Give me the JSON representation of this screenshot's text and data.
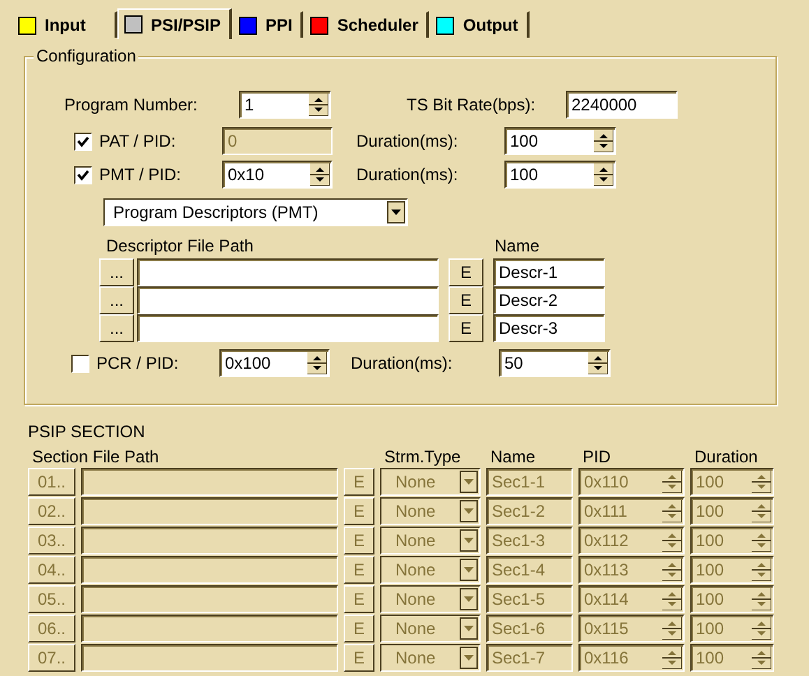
{
  "tabs": [
    {
      "label": "Input",
      "color": "#ffff00",
      "selected": false
    },
    {
      "label": "PSI/PSIP",
      "color": "#c0c0c0",
      "selected": true
    },
    {
      "label": "PPI",
      "color": "#0000ff",
      "selected": false
    },
    {
      "label": "Scheduler",
      "color": "#ff0000",
      "selected": false
    },
    {
      "label": "Output",
      "color": "#00ffff",
      "selected": false
    }
  ],
  "configuration": {
    "title": "Configuration",
    "program_number": {
      "label": "Program Number:",
      "value": "1"
    },
    "ts_bit_rate": {
      "label": "TS Bit Rate(bps):",
      "value": "2240000"
    },
    "pat": {
      "label": "PAT / PID:",
      "checked": true,
      "pid": "0",
      "pid_disabled": true,
      "duration_label": "Duration(ms):",
      "duration": "100"
    },
    "pmt": {
      "label": "PMT / PID:",
      "checked": true,
      "pid": "0x10",
      "pid_disabled": false,
      "duration_label": "Duration(ms):",
      "duration": "100"
    },
    "descriptor_type": "Program Descriptors (PMT)",
    "path_header": "Descriptor File Path",
    "name_header": "Name",
    "descriptors": [
      {
        "browse": "...",
        "edit": "E",
        "name": "Descr-1"
      },
      {
        "browse": "...",
        "edit": "E",
        "name": "Descr-2"
      },
      {
        "browse": "...",
        "edit": "E",
        "name": "Descr-3"
      }
    ],
    "pcr": {
      "label": "PCR / PID:",
      "checked": false,
      "pid": "0x100",
      "pid_disabled": false,
      "duration_label": "Duration(ms):",
      "duration": "50"
    }
  },
  "psip_section": {
    "title": "PSIP SECTION",
    "columns": [
      "Section File Path",
      "Strm.Type",
      "Name",
      "PID",
      "Duration"
    ],
    "rows": [
      {
        "file": "01..",
        "edit": "E",
        "stream_type": "None",
        "name": "Sec1-1",
        "pid": "0x110",
        "duration": "100",
        "disabled": true
      },
      {
        "file": "02..",
        "edit": "E",
        "stream_type": "None",
        "name": "Sec1-2",
        "pid": "0x111",
        "duration": "100",
        "disabled": true
      },
      {
        "file": "03..",
        "edit": "E",
        "stream_type": "None",
        "name": "Sec1-3",
        "pid": "0x112",
        "duration": "100",
        "disabled": true
      },
      {
        "file": "04..",
        "edit": "E",
        "stream_type": "None",
        "name": "Sec1-4",
        "pid": "0x113",
        "duration": "100",
        "disabled": true
      },
      {
        "file": "05..",
        "edit": "E",
        "stream_type": "None",
        "name": "Sec1-5",
        "pid": "0x114",
        "duration": "100",
        "disabled": true
      },
      {
        "file": "06..",
        "edit": "E",
        "stream_type": "None",
        "name": "Sec1-6",
        "pid": "0x115",
        "duration": "100",
        "disabled": true
      },
      {
        "file": "07..",
        "edit": "E",
        "stream_type": "None",
        "name": "Sec1-7",
        "pid": "0x116",
        "duration": "100",
        "disabled": true
      }
    ]
  }
}
